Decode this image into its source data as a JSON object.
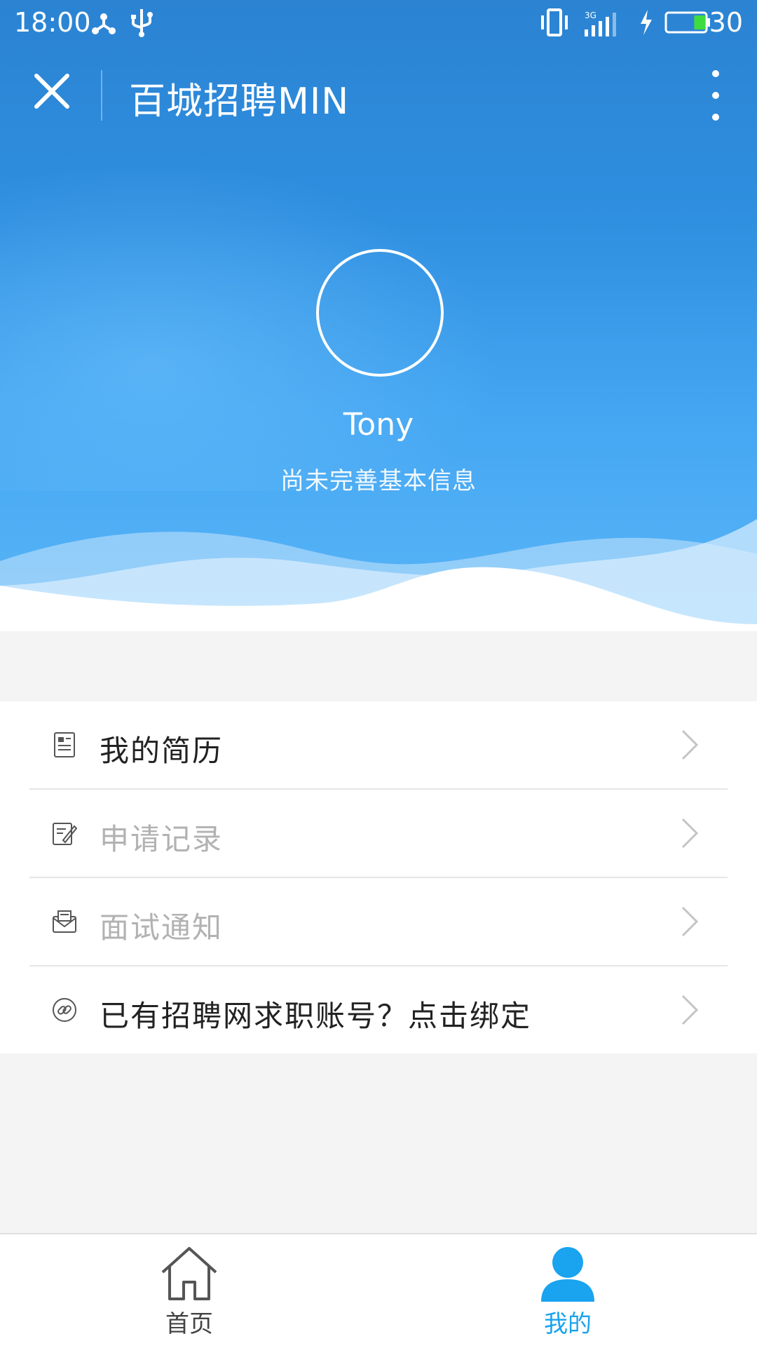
{
  "status_bar": {
    "time": "18:00",
    "network_label": "3G",
    "battery_level": "30",
    "battery_fraction": 0.3
  },
  "app_bar": {
    "title": "百城招聘MIN",
    "close_icon": "close-icon",
    "more_icon": "more-vertical-icon"
  },
  "profile": {
    "name": "Tony",
    "subtitle": "尚未完善基本信息"
  },
  "menu": {
    "items": [
      {
        "label": "我的简历",
        "icon": "resume-icon",
        "enabled": true
      },
      {
        "label": "申请记录",
        "icon": "edit-record-icon",
        "enabled": false
      },
      {
        "label": "面试通知",
        "icon": "mail-icon",
        "enabled": false
      },
      {
        "label": "已有招聘网求职账号？点击绑定",
        "icon": "link-icon",
        "enabled": true
      }
    ]
  },
  "tabs": [
    {
      "label": "首页",
      "icon": "home-icon",
      "active": false
    },
    {
      "label": "我的",
      "icon": "user-icon",
      "active": true
    }
  ],
  "colors": {
    "accent": "#1aa3ee",
    "header_top": "#2b83d2",
    "enabled_text": "#222222",
    "disabled_text": "#b2b2b2",
    "chevron": "#c4c4c4"
  }
}
